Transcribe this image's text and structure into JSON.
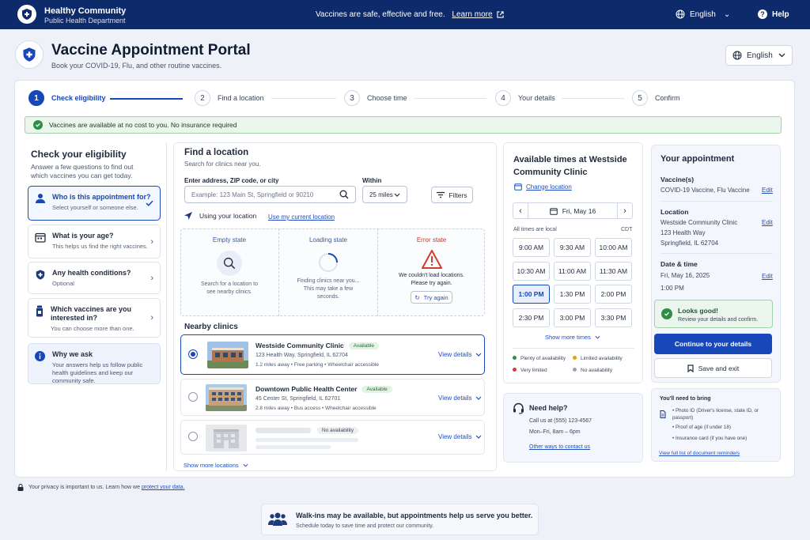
{
  "topbar": {
    "org_name": "Healthy Community",
    "org_dept": "Public Health Department",
    "banner_text": "Vaccines are safe, effective and free.",
    "banner_link": "Learn more",
    "language": "English",
    "help": "Help"
  },
  "header": {
    "title": "Vaccine Appointment Portal",
    "subtitle": "Book your COVID-19, Flu, and other routine vaccines.",
    "language_select": "English"
  },
  "stepper": [
    {
      "num": "1",
      "label": "Check eligibility"
    },
    {
      "num": "2",
      "label": "Find a location"
    },
    {
      "num": "3",
      "label": "Choose time"
    },
    {
      "num": "4",
      "label": "Your details"
    },
    {
      "num": "5",
      "label": "Confirm"
    }
  ],
  "notice": "Vaccines are available at no cost to you. No insurance required",
  "eligibility": {
    "title": "Check your eligibility",
    "subtitle": "Answer a few questions to find out which vaccines you can get today.",
    "items": [
      {
        "title": "Who is this appointment for?",
        "sub": "Select yourself or someone else."
      },
      {
        "title": "What is your age?",
        "sub": "This helps us find the right vaccines."
      },
      {
        "title": "Any health conditions?",
        "sub": "Optional"
      },
      {
        "title": "Which vaccines are you interested in?",
        "sub": "You can choose more than one."
      }
    ],
    "why_title": "Why we ask",
    "why_text": "Your answers help us follow public health guidelines and keep our community safe."
  },
  "find": {
    "title": "Find a location",
    "subtitle": "Search for clinics near you.",
    "address_label": "Enter address, ZIP code, or city",
    "address_placeholder": "Example: 123 Main St, Springfield or 90210",
    "within_label": "Within",
    "within_value": "25 miles",
    "filters": "Filters",
    "using_location": "Using your location",
    "use_current": "Use my current location",
    "empty_title": "Empty state",
    "empty_text": "Search for a location to see nearby clinics.",
    "loading_title": "Loading state",
    "loading_text": "Finding clinics near you... This may take a few seconds.",
    "error_title": "Error state",
    "error_text": "We couldn't load locations. Please try again.",
    "try_again": "Try again",
    "nearby_title": "Nearby clinics",
    "clinics": [
      {
        "name": "Westside Community Clinic",
        "badge": "Available",
        "address": "123 Health Way, Springfield, IL 62704",
        "meta": "1.2 miles away  •  Free parking  •  Wheelchair accessible"
      },
      {
        "name": "Downtown Public Health Center",
        "badge": "Available",
        "address": "45 Center St, Springfield, IL 62701",
        "meta": "2.8 miles away  •  Bus access  •  Wheelchair accessible"
      },
      {
        "name": "",
        "badge": "No availability",
        "address": "",
        "meta": ""
      }
    ],
    "view_details": "View details",
    "show_more": "Show more locations"
  },
  "times": {
    "title": "Available times at Westside Community Clinic",
    "change_location": "Change location",
    "date": "Fri, May 16",
    "local_note": "All times are local",
    "tz": "CDT",
    "slots": [
      "9:00 AM",
      "9:30 AM",
      "10:00 AM",
      "10:30 AM",
      "11:00 AM",
      "11:30 AM",
      "1:00 PM",
      "1:30 PM",
      "2:00 PM",
      "2:30 PM",
      "3:00 PM",
      "3:30 PM"
    ],
    "show_more": "Show more times",
    "legend": [
      {
        "label": "Plenty of availability",
        "color": "#2c8f45"
      },
      {
        "label": "Limited availability",
        "color": "#e2a012"
      },
      {
        "label": "Very limited",
        "color": "#d23b2f"
      },
      {
        "label": "No availability",
        "color": "#9aa3b2"
      }
    ]
  },
  "help": {
    "title": "Need help?",
    "phone": "Call us at (555) 123-4567",
    "hours": "Mon–Fri, 8am – 6pm",
    "other": "Other ways to contact us"
  },
  "appointment": {
    "title": "Your appointment",
    "vaccines_label": "Vaccine(s)",
    "vaccines": "COVID-19 Vaccine, Flu Vaccine",
    "location_label": "Location",
    "location_1": "Westside Community Clinic",
    "location_2": "123 Health Way",
    "location_3": "Springfield, IL 62704",
    "datetime_label": "Date & time",
    "date": "Fri, May 16, 2025",
    "time": "1:00 PM",
    "edit": "Edit",
    "looks_good": "Looks good!",
    "review": "Review your details and confirm.",
    "continue": "Continue to your details",
    "save_exit": "Save and exit"
  },
  "bring": {
    "title": "You'll need to bring",
    "items": [
      "Photo ID (Driver's license, state ID, or passport)",
      "Proof of age (if under 18)",
      "Insurance card (if you have one)"
    ],
    "link": "View full list of document reminders"
  },
  "footer": {
    "privacy": "Your privacy is important to us. Learn how we",
    "privacy_link": "protect your data.",
    "walkin_title": "Walk-ins may be available, but appointments help us serve you better.",
    "walkin_sub": "Schedule today to save time and protect our community."
  }
}
